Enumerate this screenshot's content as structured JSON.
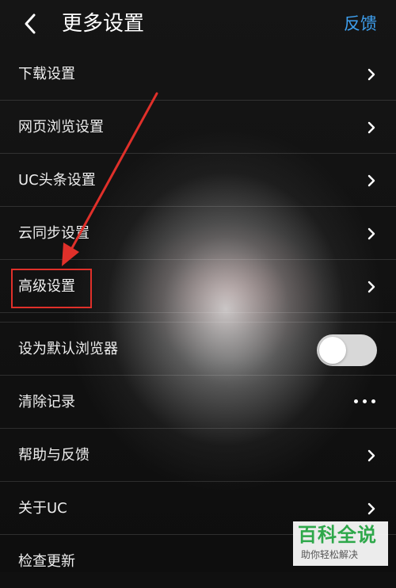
{
  "header": {
    "title": "更多设置",
    "feedback_label": "反馈",
    "back_icon": "chevron-left-icon"
  },
  "settings_group_1": [
    {
      "label": "下载设置",
      "icon": "chevron-right-icon"
    },
    {
      "label": "网页浏览设置",
      "icon": "chevron-right-icon"
    },
    {
      "label": "UC头条设置",
      "icon": "chevron-right-icon"
    },
    {
      "label": "云同步设置",
      "icon": "chevron-right-icon"
    },
    {
      "label": "高级设置",
      "icon": "chevron-right-icon"
    }
  ],
  "settings_group_2": {
    "default_browser": {
      "label": "设为默认浏览器",
      "toggle_on": false
    },
    "clear_records": {
      "label": "清除记录",
      "icon": "more-dots-icon"
    },
    "help_feedback": {
      "label": "帮助与反馈",
      "icon": "chevron-right-icon"
    },
    "about": {
      "label": "关于UC",
      "icon": "chevron-right-icon"
    },
    "check_update": {
      "label": "检查更新"
    }
  },
  "watermark": {
    "title": "百科全说",
    "subtitle": "助你轻松解决"
  },
  "colors": {
    "accent": "#3ea0f0",
    "highlight": "#e0302a",
    "watermark_green": "#2ea84a"
  }
}
